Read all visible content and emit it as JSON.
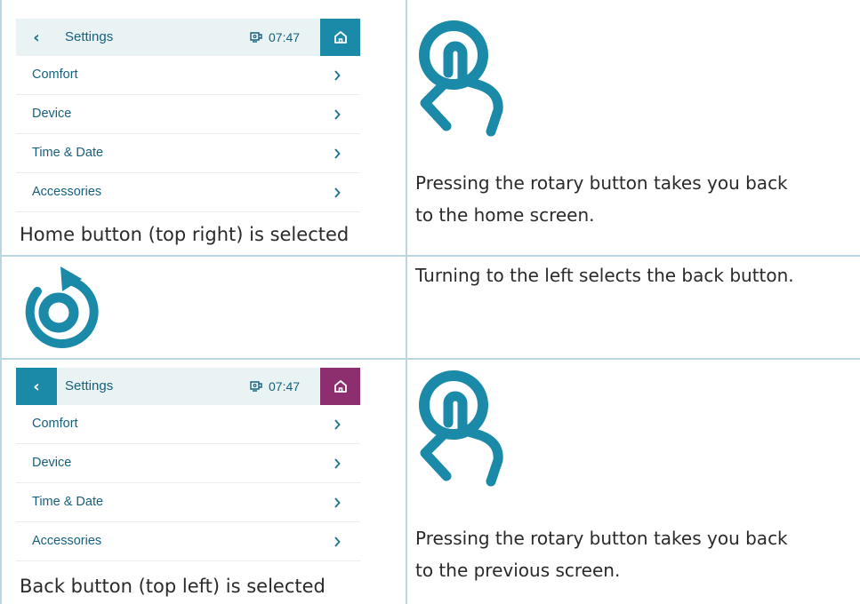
{
  "colors": {
    "accent": "#1b8aa8",
    "home_selected_alt": "#8d2f6e",
    "screen_header_bg": "#e9f3f3",
    "border": "#b9d6e2"
  },
  "steps": [
    {
      "screen": {
        "title": "Settings",
        "time": "07:47",
        "status_icon": "boiler-icon",
        "home_icon": "home-icon",
        "back_icon": "chevron-left-icon",
        "items": [
          "Comfort",
          "Device",
          "Time & Date",
          "Accessories"
        ]
      },
      "caption": "Home button (top right) is selected",
      "action_icon": "finger-press-icon",
      "description": [
        "Pressing the rotary button takes you back",
        "to the home screen."
      ]
    },
    {
      "action_icon": "rotate-left-icon",
      "description": [
        "Turning to the left selects the back button."
      ]
    },
    {
      "screen": {
        "title": "Settings",
        "time": "07:47",
        "status_icon": "boiler-icon",
        "home_icon": "home-icon",
        "back_icon": "chevron-left-icon",
        "items": [
          "Comfort",
          "Device",
          "Time & Date",
          "Accessories"
        ]
      },
      "caption": "Back button (top left) is selected",
      "action_icon": "finger-press-icon",
      "description": [
        "Pressing the rotary button takes you back",
        "to the previous screen."
      ]
    }
  ]
}
